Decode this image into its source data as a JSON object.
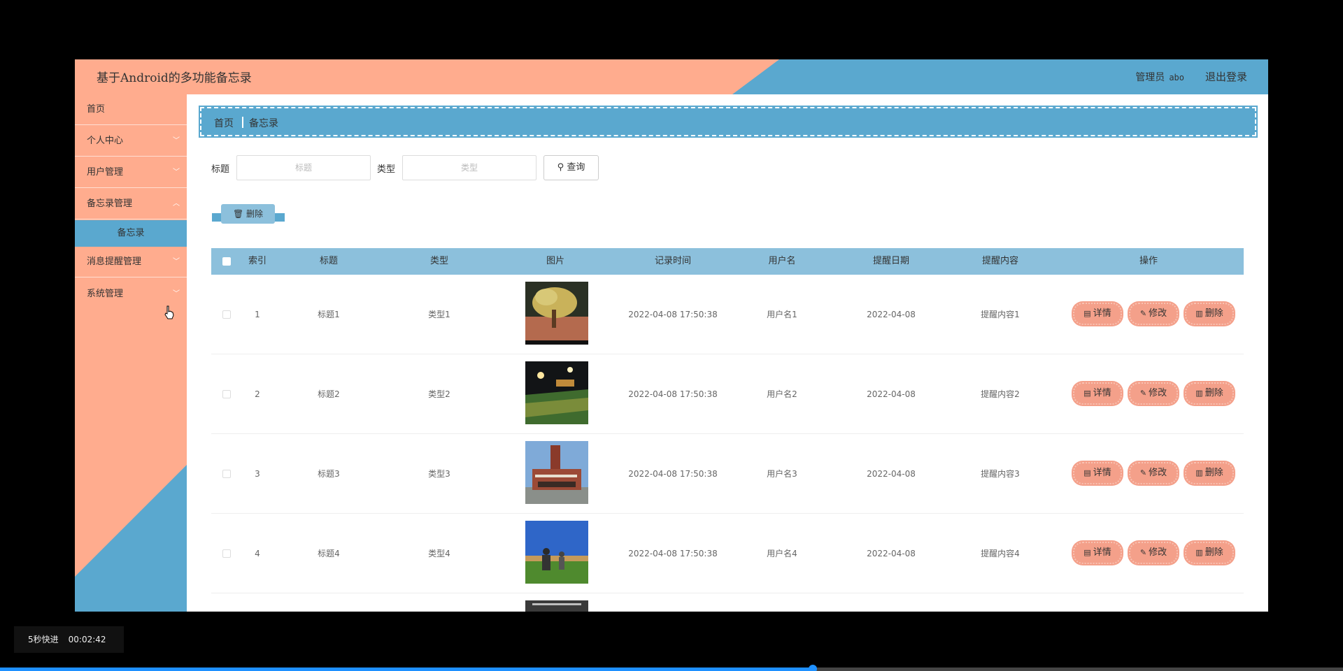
{
  "app": {
    "title": "基于Android的多功能备忘录",
    "user_role": "管理员",
    "username": "abo",
    "logout": "退出登录"
  },
  "sidebar": {
    "items": [
      {
        "label": "首页"
      },
      {
        "label": "个人中心"
      },
      {
        "label": "用户管理"
      },
      {
        "label": "备忘录管理"
      },
      {
        "label": "消息提醒管理"
      },
      {
        "label": "系统管理"
      }
    ],
    "subitem": {
      "label": "备忘录"
    }
  },
  "breadcrumb": {
    "home": "首页",
    "current": "备忘录"
  },
  "search": {
    "title_label": "标题",
    "title_placeholder": "标题",
    "type_label": "类型",
    "type_placeholder": "类型",
    "query_button": "查询"
  },
  "batch_delete": "删除",
  "table": {
    "columns": [
      "索引",
      "标题",
      "类型",
      "图片",
      "记录时间",
      "用户名",
      "提醒日期",
      "提醒内容",
      "操作"
    ],
    "rows": [
      {
        "index": "1",
        "title": "标题1",
        "type": "类型1",
        "time": "2022-04-08 17:50:38",
        "user": "用户名1",
        "date": "2022-04-08",
        "content": "提醒内容1"
      },
      {
        "index": "2",
        "title": "标题2",
        "type": "类型2",
        "time": "2022-04-08 17:50:38",
        "user": "用户名2",
        "date": "2022-04-08",
        "content": "提醒内容2"
      },
      {
        "index": "3",
        "title": "标题3",
        "type": "类型3",
        "time": "2022-04-08 17:50:38",
        "user": "用户名3",
        "date": "2022-04-08",
        "content": "提醒内容3"
      },
      {
        "index": "4",
        "title": "标题4",
        "type": "类型4",
        "time": "2022-04-08 17:50:38",
        "user": "用户名4",
        "date": "2022-04-08",
        "content": "提醒内容4"
      }
    ],
    "actions": {
      "detail": "详情",
      "edit": "修改",
      "delete": "删除"
    }
  },
  "player": {
    "skip_label": "5秒快进",
    "timestamp": "00:02:42",
    "progress": 0.605
  },
  "colors": {
    "orange": "#ffac8e",
    "blue": "#5aa8cf",
    "light_blue": "#8cc0dc",
    "button_salmon": "#f4a08a"
  }
}
